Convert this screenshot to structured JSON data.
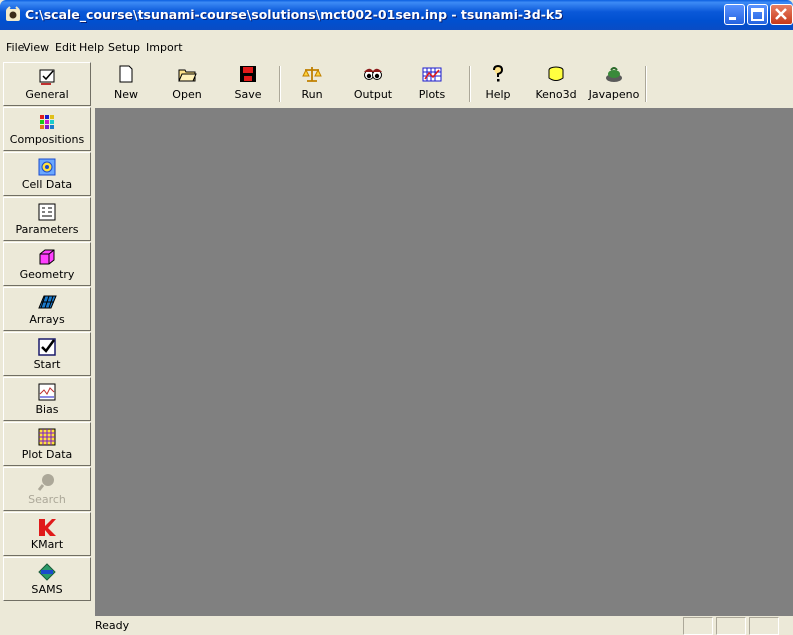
{
  "window": {
    "title": "C:\\scale_course\\tsunami-course\\solutions\\mct002-01sen.inp - tsunami-3d-k5",
    "app_icon": "duke-icon",
    "controls": [
      "minimize-icon",
      "maximize-icon",
      "close-icon"
    ]
  },
  "menu": [
    "File",
    "View",
    "Edit",
    "Help",
    "Setup",
    "Import"
  ],
  "toolbar": [
    {
      "label": "New",
      "icon": "new-document-icon"
    },
    {
      "label": "Open",
      "icon": "open-folder-icon"
    },
    {
      "label": "Save",
      "icon": "save-disk-icon"
    },
    {
      "label": "Run",
      "icon": "run-scales-icon"
    },
    {
      "label": "Output",
      "icon": "output-eyes-icon"
    },
    {
      "label": "Plots",
      "icon": "plots-grid-icon"
    },
    {
      "label": "Help",
      "icon": "help-icon"
    },
    {
      "label": "Keno3d",
      "icon": "keno3d-icon"
    },
    {
      "label": "Javapeno",
      "icon": "javapeno-icon"
    }
  ],
  "sidebar": [
    {
      "label": "General",
      "icon": "general-icon",
      "enabled": true
    },
    {
      "label": "Compositions",
      "icon": "compositions-icon",
      "enabled": true
    },
    {
      "label": "Cell Data",
      "icon": "cell-data-icon",
      "enabled": true
    },
    {
      "label": "Parameters",
      "icon": "parameters-icon",
      "enabled": true
    },
    {
      "label": "Geometry",
      "icon": "geometry-cube-icon",
      "enabled": true
    },
    {
      "label": "Arrays",
      "icon": "arrays-icon",
      "enabled": true
    },
    {
      "label": "Start",
      "icon": "start-checkbox-icon",
      "enabled": true
    },
    {
      "label": "Bias",
      "icon": "bias-chart-icon",
      "enabled": true
    },
    {
      "label": "Plot Data",
      "icon": "plot-data-icon",
      "enabled": true
    },
    {
      "label": "Search",
      "icon": "search-icon",
      "enabled": false
    },
    {
      "label": "KMart",
      "icon": "kmart-logo-icon",
      "enabled": true
    },
    {
      "label": "SAMS",
      "icon": "sams-logo-icon",
      "enabled": true
    }
  ],
  "status": {
    "text": "Ready"
  },
  "colors": {
    "titlebar": "#0a58d8",
    "workspace": "#808080",
    "chrome": "#ece9d8"
  }
}
